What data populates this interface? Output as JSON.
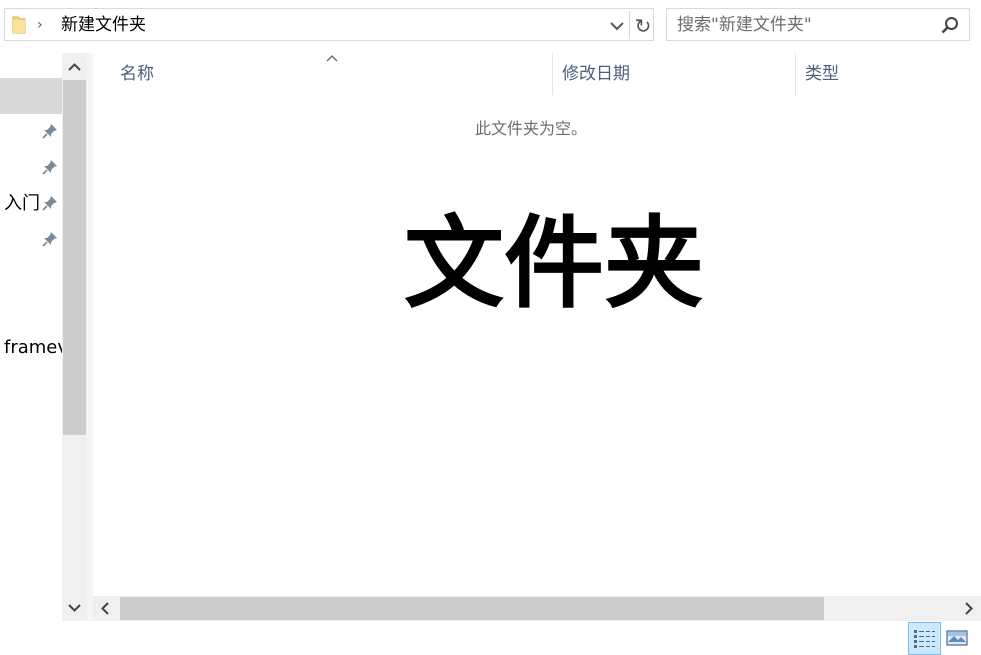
{
  "address_bar": {
    "path_segment": "新建文件夹",
    "refresh_glyph": "↻"
  },
  "search": {
    "placeholder": "搜索\"新建文件夹\""
  },
  "nav": {
    "items": [
      {
        "label": "",
        "pinned": true
      },
      {
        "label": "",
        "pinned": true
      },
      {
        "label": "入门",
        "pinned": true
      },
      {
        "label": "",
        "pinned": true
      }
    ],
    "truncated_item": "framev"
  },
  "columns": [
    {
      "label": "名称"
    },
    {
      "label": "修改日期"
    },
    {
      "label": "类型"
    }
  ],
  "content": {
    "empty_message": "此文件夹为空。",
    "overlay_title": "文件夹"
  },
  "colors": {
    "header_text": "#4c607a",
    "selected_view_bg": "#cce8ff",
    "selected_view_border": "#7dbde8",
    "folder_yellow": "#f8d775"
  }
}
